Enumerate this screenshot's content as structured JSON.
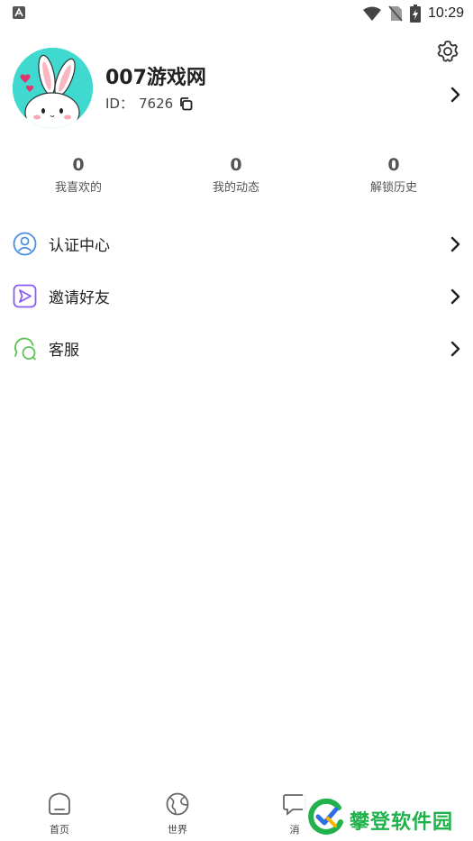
{
  "status_bar": {
    "time": "10:29"
  },
  "profile": {
    "name": "007游戏网",
    "id_label": "ID：",
    "id_value": "7626"
  },
  "stats": [
    {
      "value": "0",
      "label": "我喜欢的"
    },
    {
      "value": "0",
      "label": "我的动态"
    },
    {
      "value": "0",
      "label": "解锁历史"
    }
  ],
  "menu": [
    {
      "label": "认证中心",
      "icon": "user-circle-icon",
      "color": "#4a90e2"
    },
    {
      "label": "邀请好友",
      "icon": "send-icon",
      "color": "#8a5cf6"
    },
    {
      "label": "客服",
      "icon": "chat-bubbles-icon",
      "color": "#5cc45a"
    }
  ],
  "tab_bar": {
    "tabs": [
      {
        "label": "首页",
        "icon": "home-icon"
      },
      {
        "label": "世界",
        "icon": "globe-icon"
      },
      {
        "label": "消",
        "icon": "message-icon"
      }
    ]
  },
  "watermark": {
    "text": "攀登软件园"
  },
  "colors": {
    "avatar_bg": "#3fd9d0",
    "accent_green": "#20b24a"
  }
}
